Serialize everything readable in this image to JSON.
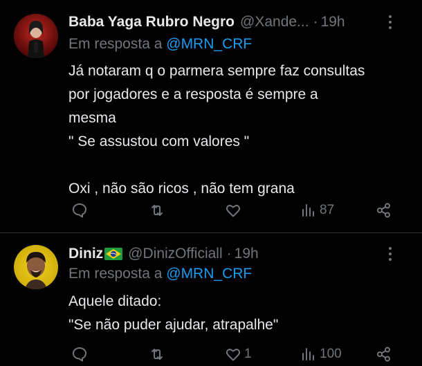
{
  "tweets": [
    {
      "name": "Baba Yaga Rubro Negro",
      "handle": "@Xande...",
      "separator": "·",
      "time": "19h",
      "reply_prefix": "Em resposta a",
      "reply_to": "@MRN_CRF",
      "lines": [
        "Já notaram q o parmera sempre faz consultas",
        "por jogadores e a resposta é sempre a",
        "mesma",
        "\" Se assustou com valores \"",
        "",
        "Oxi , não são ricos , não tem grana"
      ],
      "views": "87",
      "likes": "",
      "retweets": "",
      "replies": ""
    },
    {
      "name": "Diniz",
      "flag": "brazil-flag",
      "handle": "@DinizOfficiall",
      "separator": "·",
      "time": "19h",
      "reply_prefix": "Em resposta a",
      "reply_to": "@MRN_CRF",
      "lines": [
        "Aquele ditado:",
        "\"Se não puder ajudar, atrapalhe\""
      ],
      "views": "100",
      "likes": "1",
      "retweets": "",
      "replies": ""
    }
  ],
  "colors": {
    "background": "#000000",
    "text": "#e7e9ea",
    "muted": "#71767b",
    "link": "#1d9bf0",
    "divider": "#2f3336"
  }
}
